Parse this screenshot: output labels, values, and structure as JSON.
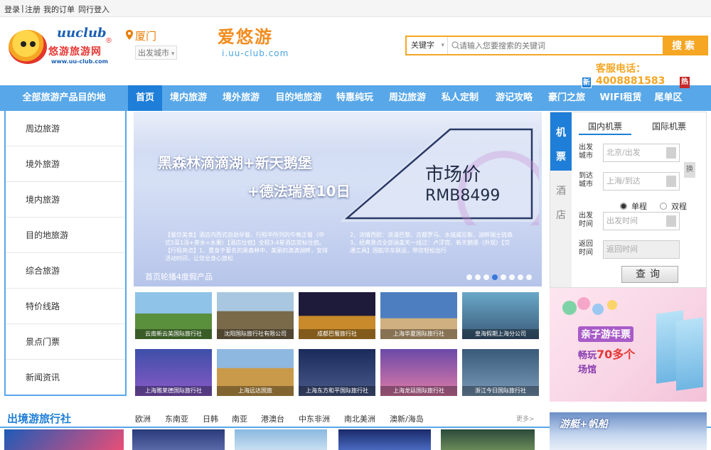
{
  "topbar": {
    "login": "登录",
    "sep": "|",
    "register": "注册",
    "orders": "我的订单",
    "companion": "同行登入"
  },
  "header": {
    "logo": {
      "uu": "uuclub",
      "name": "悠游旅游网",
      "url": "www.uu-club.com",
      "reg": "®"
    },
    "city": "厦门",
    "city_select": "出发城市",
    "brand": "爱悠游",
    "brand_url": "i.uu-club.com",
    "search": {
      "type": "关键字",
      "placeholder": "请输入您要搜索的关键词",
      "button": "搜索"
    },
    "hotline": "客服电话：4008881583"
  },
  "nav": {
    "all": "全部旅游产品目的地",
    "items": [
      {
        "label": "首页",
        "active": true
      },
      {
        "label": "境内旅游"
      },
      {
        "label": "境外旅游"
      },
      {
        "label": "目的地旅游"
      },
      {
        "label": "特惠纯玩"
      },
      {
        "label": "周边旅游"
      },
      {
        "label": "私人定制"
      },
      {
        "label": "游记攻略"
      },
      {
        "label": "豪门之旅",
        "badge": "新"
      },
      {
        "label": "WIFI租赁"
      },
      {
        "label": "尾单区",
        "badge": "热"
      }
    ]
  },
  "sidebar": [
    "周边旅游",
    "境外旅游",
    "境内旅游",
    "目的地旅游",
    "综合旅游",
    "特价线路",
    "景点门票",
    "新闻资讯"
  ],
  "banner": {
    "line1": "黑森林滴滴湖+新天鹅堡",
    "line2": "+德法瑞意10日",
    "price_label": "市场价",
    "price": "RMB8499",
    "desc_left": "【餐饮美食】酒店内西式自助早餐，行程中所列的午晚正餐（中 式5菜1汤+茶水+水果）【酒店住宿】全程3-4星酒店双标住宿。【行程亮点】1、置身于著名的黑森林中、美丽的滴滴湖畔，安排活动时间，让您全身心放松",
    "desc_right": "2、浓情西欧：浪漫巴黎、古都罗马、水城威尼斯、湖畔瑞士琉森 3、经典景点全部涵盖天一线过：卢浮宫、新天鹅堡（外观）【交通工具】国航华东联运，带您轻松出行",
    "caption": "首页轮播4度假产品",
    "dots": 8,
    "active_dot": 3
  },
  "flight": {
    "vtabs": [
      "机",
      "票",
      "酒",
      "店"
    ],
    "htabs": [
      "国内机票",
      "国际机票"
    ],
    "depart_city_label": "出发城市",
    "depart_city": "北京/出发",
    "arrive_city_label": "到达城市",
    "arrive_city": "上海/到达",
    "swap": "换",
    "one_way": "单程",
    "round_trip": "双程",
    "depart_time_label": "出发时间",
    "depart_time": "出发时间",
    "return_time_label": "返回时间",
    "return_time": "返回时间",
    "search": "查询"
  },
  "ad": {
    "line1": "亲子游年票",
    "line2a": "畅玩",
    "line2b": "70多个",
    "line3": "场馆"
  },
  "tiles": [
    {
      "caption": "云南新云美国际旅行社",
      "bg": "#5a8f3c"
    },
    {
      "caption": "沈阳国际旅行社有限公司",
      "bg": "#7a6a4a"
    },
    {
      "caption": "成都巴蜀旅行社",
      "bg": "#2b1f4a"
    },
    {
      "caption": "上海华夏国际旅行社",
      "bg": "#3d6fb0"
    },
    {
      "caption": "皇海假期上海分公司",
      "bg": "#6aa8c8"
    },
    {
      "caption": "上海雅莱德国际旅行社",
      "bg": "#3d4fa8"
    },
    {
      "caption": "上海远达国旅",
      "bg": "#c89a4a"
    },
    {
      "caption": "上海东方和平国际旅行社",
      "bg": "#2a3a6a"
    },
    {
      "caption": "上海龙廷国际旅行社",
      "bg": "#6a4aa8"
    },
    {
      "caption": "浙江今日国际旅行社",
      "bg": "#4a6a8a"
    }
  ],
  "section": {
    "title": "出境游旅行社",
    "tabs": [
      "欧洲",
      "东南亚",
      "日韩",
      "南亚",
      "港澳台",
      "中东非洲",
      "南北美洲",
      "澳新/海岛"
    ],
    "more": "更多>"
  },
  "yacht": {
    "title": "游艇+帆船"
  }
}
